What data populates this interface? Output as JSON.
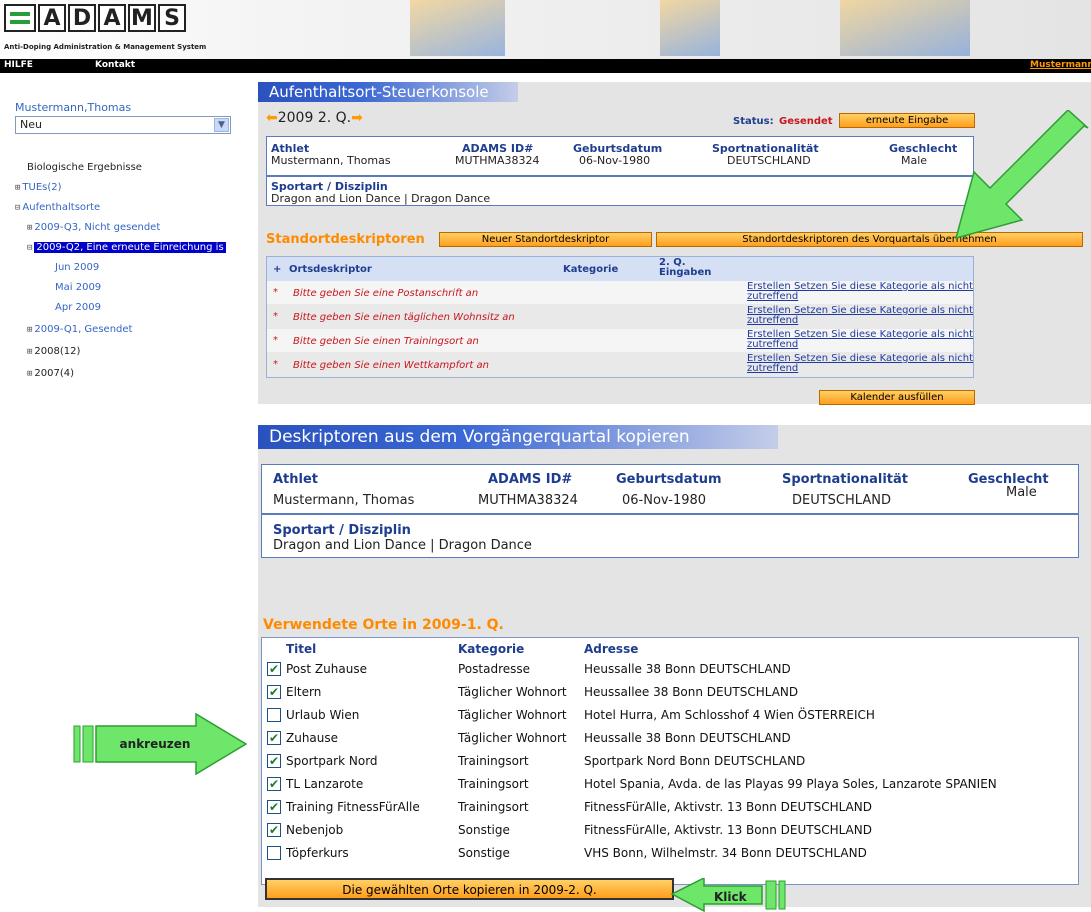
{
  "header": {
    "logo_letters": [
      "A",
      "D",
      "A",
      "M",
      "S"
    ],
    "tagline": "Anti-Doping Administration & Management System"
  },
  "topbar": {
    "hilfe": "HILFE",
    "kontakt": "Kontakt",
    "user": "Mustermann"
  },
  "sidebar": {
    "name": "Mustermann,Thomas",
    "select_value": "Neu",
    "tree": [
      "Biologische Ergebnisse",
      "TUEs(2)",
      "Aufenthaltsorte",
      "2009-Q3, Nicht gesendet",
      "2009-Q2, Eine erneute Einreichung is",
      "Jun 2009",
      "Mai 2009",
      "Apr 2009",
      "2009-Q1, Gesendet",
      "2008(12)",
      "2007(4)"
    ]
  },
  "panel1": {
    "title": "Aufenthaltsort-Steuerkonsole",
    "quarter": "2009 2. Q.",
    "status_label": "Status:",
    "status_value": "Gesendet",
    "resubmit_button": "erneute Eingabe",
    "athlet_label": "Athlet",
    "athlet_value": "Mustermann, Thomas",
    "id_label": "ADAMS ID#",
    "id_value": "MUTHMA38324",
    "dob_label": "Geburtsdatum",
    "dob_value": "06-Nov-1980",
    "nat_label": "Sportnationalität",
    "nat_value": "DEUTSCHLAND",
    "gender_label": "Geschlecht",
    "gender_value": "Male",
    "sport_label": "Sportart / Disziplin",
    "sport_value": "Dragon and Lion Dance | Dragon Dance",
    "descriptors_title": "Standortdeskriptoren",
    "new_descriptor_button": "Neuer Standortdeskriptor",
    "copy_prev_button": "Standortdeskriptoren des Vorquartals übernehmen",
    "table_header": {
      "plus": "+",
      "ortsdeskriptor": "Ortsdeskriptor",
      "kategorie": "Kategorie",
      "eingaben": "2. Q. Eingaben"
    },
    "rows": [
      "Bitte geben Sie eine Postanschrift an",
      "Bitte geben Sie einen täglichen Wohnsitz an",
      "Bitte geben Sie einen Trainingsort an",
      "Bitte geben Sie einen Wettkampfort an"
    ],
    "row_star": "*",
    "action_create": "Erstellen",
    "action_na": "Setzen Sie diese Kategorie als nicht zutreffend",
    "calendar_button": "Kalender ausfüllen"
  },
  "panel2": {
    "title": "Deskriptoren aus dem Vorgängerquartal kopieren",
    "athlet_label": "Athlet",
    "athlet_value": "Mustermann, Thomas",
    "id_label": "ADAMS ID#",
    "id_value": "MUTHMA38324",
    "dob_label": "Geburtsdatum",
    "dob_value": "06-Nov-1980",
    "nat_label": "Sportnationalität",
    "nat_value": "DEUTSCHLAND",
    "gender_label": "Geschlecht",
    "gender_value": "Male",
    "sport_label": "Sportart / Disziplin",
    "sport_value": "Dragon and Lion Dance | Dragon Dance",
    "orte_title": "Verwendete Orte in 2009-1. Q.",
    "cols": [
      "Titel",
      "Kategorie",
      "Adresse"
    ],
    "places": [
      {
        "checked": true,
        "title": "Post Zuhause",
        "category": "Postadresse",
        "address": "Heussalle 38 Bonn DEUTSCHLAND"
      },
      {
        "checked": true,
        "title": "Eltern",
        "category": "Täglicher Wohnort",
        "address": "Heussallee 38 Bonn DEUTSCHLAND"
      },
      {
        "checked": false,
        "title": "Urlaub Wien",
        "category": "Täglicher Wohnort",
        "address": "Hotel Hurra, Am Schlosshof 4 Wien ÖSTERREICH"
      },
      {
        "checked": true,
        "title": "Zuhause",
        "category": "Täglicher Wohnort",
        "address": "Heussalle 38 Bonn DEUTSCHLAND"
      },
      {
        "checked": true,
        "title": "Sportpark Nord",
        "category": "Trainingsort",
        "address": "Sportpark Nord Bonn DEUTSCHLAND"
      },
      {
        "checked": true,
        "title": "TL Lanzarote",
        "category": "Trainingsort",
        "address": "Hotel Spania, Avda. de las Playas 99 Playa Soles, Lanzarote SPANIEN"
      },
      {
        "checked": true,
        "title": "Training FitnessFürAlle",
        "category": "Trainingsort",
        "address": "FitnessFürAlle, Aktivstr. 13 Bonn DEUTSCHLAND"
      },
      {
        "checked": true,
        "title": "Nebenjob",
        "category": "Sonstige",
        "address": "FitnessFürAlle, Aktivstr. 13 Bonn DEUTSCHLAND"
      },
      {
        "checked": false,
        "title": "Töpferkurs",
        "category": "Sonstige",
        "address": "VHS Bonn, Wilhelmstr. 34 Bonn DEUTSCHLAND"
      }
    ],
    "copy_button": "Die gewählten Orte kopieren in 2009-2. Q."
  },
  "callouts": {
    "ankreuzen": "ankreuzen",
    "klick": "Klick"
  },
  "colors": {
    "accent_orange": "#ff8a00",
    "status_red": "#c8161d",
    "header_blue": "#2a52be",
    "callout_green": "#5fd35a"
  }
}
